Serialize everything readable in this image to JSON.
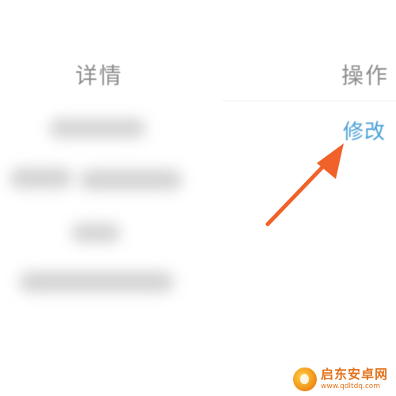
{
  "table": {
    "header_detail": "详情",
    "header_action": "操作",
    "edit_link": "修改"
  },
  "watermark": {
    "name": "启东安卓网",
    "url": "www.qdltdq.com"
  },
  "colors": {
    "header_text": "#8c8c8c",
    "link": "#4a9fd8",
    "arrow": "#f0622a",
    "watermark": "#e2731c"
  },
  "icons": {
    "annotation_arrow": "arrow-icon",
    "watermark_logo": "watermark-logo-icon"
  }
}
